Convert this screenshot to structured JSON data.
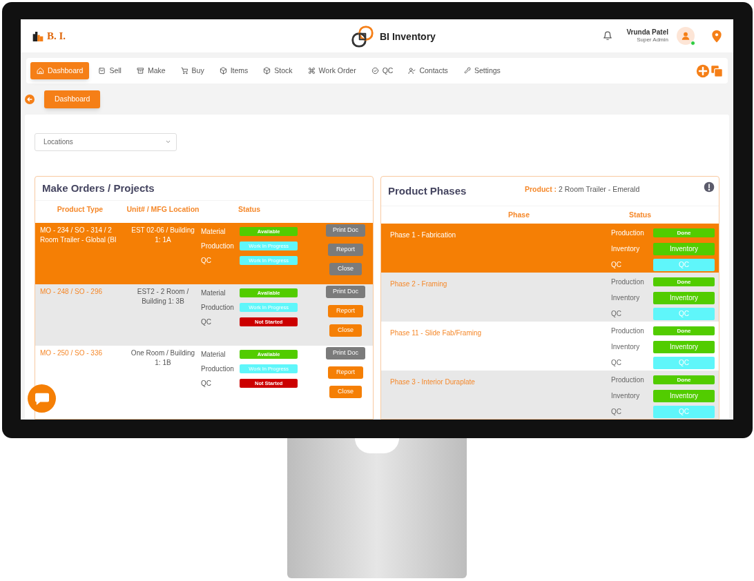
{
  "header": {
    "logo": "B. I.",
    "app_name": "BI Inventory",
    "user_name": "Vrunda Patel",
    "user_role": "Super Admin",
    "user_online": true
  },
  "nav": [
    {
      "label": "Dashboard",
      "selected": true
    },
    {
      "label": "Sell",
      "selected": false
    },
    {
      "label": "Make",
      "selected": false
    },
    {
      "label": "Buy",
      "selected": false
    },
    {
      "label": "Items",
      "selected": false
    },
    {
      "label": "Stock",
      "selected": false
    },
    {
      "label": "Work Order",
      "selected": false
    },
    {
      "label": "QC",
      "selected": false
    },
    {
      "label": "Contacts",
      "selected": false
    },
    {
      "label": "Settings",
      "selected": false
    }
  ],
  "breadcrumb": "Dashboard",
  "locations": {
    "placeholder": "Locations"
  },
  "make_orders": {
    "title": "Make Orders / Projects",
    "columns": [
      "Product Type",
      "Unit# / MFG Location",
      "Status"
    ],
    "rows": [
      {
        "product_type": "MO - 234 / SO - 314 / 2 Room Trailer - Global (BI",
        "unit_location": "EST 02-06 / Building 1: 1A",
        "selected": true,
        "statuses": [
          {
            "label": "Material",
            "value": "Available",
            "kind": "available"
          },
          {
            "label": "Production",
            "value": "Work In Progress",
            "kind": "in_progress"
          },
          {
            "label": "QC",
            "value": "Work In Progress",
            "kind": "in_progress"
          }
        ],
        "actions": [
          {
            "label": "Print Doc",
            "kind": "print"
          },
          {
            "label": "Report",
            "kind": "report"
          },
          {
            "label": "Close",
            "kind": "close"
          }
        ]
      },
      {
        "product_type": "MO - 248 / SO - 296",
        "unit_location": "EST2 - 2 Room / Building 1: 3B",
        "selected": false,
        "statuses": [
          {
            "label": "Material",
            "value": "Available",
            "kind": "available"
          },
          {
            "label": "Production",
            "value": "Work In Progress",
            "kind": "in_progress"
          },
          {
            "label": "QC",
            "value": "Not Started",
            "kind": "not_started"
          }
        ],
        "actions": [
          {
            "label": "Print Doc",
            "kind": "print"
          },
          {
            "label": "Report",
            "kind": "report"
          },
          {
            "label": "Close",
            "kind": "close"
          }
        ]
      },
      {
        "product_type": "MO - 250 / SO - 336",
        "unit_location": "One Room / Building 1: 1B",
        "selected": false,
        "statuses": [
          {
            "label": "Material",
            "value": "Available",
            "kind": "available"
          },
          {
            "label": "Production",
            "value": "Work In Progress",
            "kind": "in_progress"
          },
          {
            "label": "QC",
            "value": "Not Started",
            "kind": "not_started"
          }
        ],
        "actions": [
          {
            "label": "Print Doc",
            "kind": "print"
          },
          {
            "label": "Report",
            "kind": "report"
          },
          {
            "label": "Close",
            "kind": "close"
          }
        ]
      }
    ]
  },
  "product_phases": {
    "title": "Product Phases",
    "product_label": "Product :",
    "product_value": "2 Room Trailer - Emerald",
    "columns": [
      "Phase",
      "Status"
    ],
    "rows": [
      {
        "name": "Phase 1 - Fabrication",
        "selected": true,
        "statuses": [
          {
            "label": "Production",
            "value": "Done",
            "kind": "done"
          },
          {
            "label": "Inventory",
            "value": "Inventory",
            "kind": "inventory"
          },
          {
            "label": "QC",
            "value": "QC",
            "kind": "qc"
          }
        ]
      },
      {
        "name": "Phase 2 - Framing",
        "selected": false,
        "statuses": [
          {
            "label": "Production",
            "value": "Done",
            "kind": "done"
          },
          {
            "label": "Inventory",
            "value": "Inventory",
            "kind": "inventory"
          },
          {
            "label": "QC",
            "value": "QC",
            "kind": "qc"
          }
        ]
      },
      {
        "name": "Phase 11 - Slide Fab/Framing",
        "selected": false,
        "statuses": [
          {
            "label": "Production",
            "value": "Done",
            "kind": "done"
          },
          {
            "label": "Inventory",
            "value": "Inventory",
            "kind": "inventory"
          },
          {
            "label": "QC",
            "value": "QC",
            "kind": "qc"
          }
        ]
      },
      {
        "name": "Phase 3 - Interior Duraplate",
        "selected": false,
        "statuses": [
          {
            "label": "Production",
            "value": "Done",
            "kind": "done"
          },
          {
            "label": "Inventory",
            "value": "Inventory",
            "kind": "inventory"
          },
          {
            "label": "QC",
            "value": "QC",
            "kind": "qc"
          }
        ]
      }
    ]
  }
}
